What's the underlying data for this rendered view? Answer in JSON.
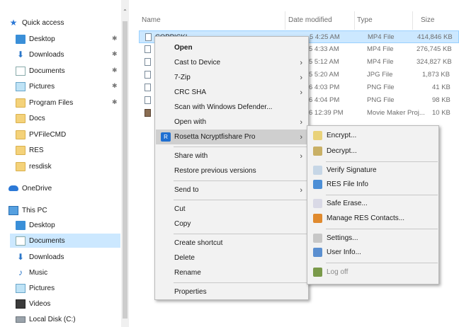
{
  "sidebar": {
    "items": [
      {
        "label": "Quick access",
        "icon": "star-icon",
        "pinned": false
      },
      {
        "label": "Desktop",
        "icon": "desktop-folder-icon",
        "pinned": true
      },
      {
        "label": "Downloads",
        "icon": "download-arrow-icon",
        "pinned": true
      },
      {
        "label": "Documents",
        "icon": "document-icon",
        "pinned": true
      },
      {
        "label": "Pictures",
        "icon": "pictures-icon",
        "pinned": true
      },
      {
        "label": "Program Files",
        "icon": "folder-icon",
        "pinned": true
      },
      {
        "label": "Docs",
        "icon": "folder-icon",
        "pinned": false
      },
      {
        "label": "PVFileCMD",
        "icon": "folder-icon",
        "pinned": false
      },
      {
        "label": "RES",
        "icon": "folder-icon",
        "pinned": false
      },
      {
        "label": "resdisk",
        "icon": "folder-icon",
        "pinned": false
      },
      {
        "label": "OneDrive",
        "icon": "cloud-icon",
        "pinned": false
      },
      {
        "label": "This PC",
        "icon": "computer-icon",
        "pinned": false
      },
      {
        "label": "Desktop",
        "icon": "desktop-folder-icon",
        "pinned": false
      },
      {
        "label": "Documents",
        "icon": "document-icon",
        "pinned": false
      },
      {
        "label": "Downloads",
        "icon": "download-arrow-icon",
        "pinned": false
      },
      {
        "label": "Music",
        "icon": "music-icon",
        "pinned": false
      },
      {
        "label": "Pictures",
        "icon": "pictures-icon",
        "pinned": false
      },
      {
        "label": "Videos",
        "icon": "video-icon",
        "pinned": false
      },
      {
        "label": "Local Disk (C:)",
        "icon": "disk-icon",
        "pinned": false
      }
    ],
    "pin_glyph": "✱"
  },
  "header": {
    "name": "Name",
    "date_modified": "Date modified",
    "type": "Type",
    "size": "Size",
    "sort_glyph": "⌃"
  },
  "files": [
    {
      "name": "COPPICKI",
      "date": "5 4:25 AM",
      "type": "MP4 File",
      "size": "414,846 KB"
    },
    {
      "name": "",
      "date": "5 4:33 AM",
      "type": "MP4 File",
      "size": "276,745 KB"
    },
    {
      "name": "",
      "date": "5 5:12 AM",
      "type": "MP4 File",
      "size": "324,827 KB"
    },
    {
      "name": "",
      "date": "5 5:20 AM",
      "type": "JPG File",
      "size": "1,873 KB"
    },
    {
      "name": "",
      "date": "6 4:03 PM",
      "type": "PNG File",
      "size": "41 KB"
    },
    {
      "name": "",
      "date": "6 4:04 PM",
      "type": "PNG File",
      "size": "98 KB"
    },
    {
      "name": "",
      "date": "6 12:39 PM",
      "type": "Movie Maker Proj...",
      "size": "10 KB"
    }
  ],
  "context_menu": {
    "items": [
      {
        "label": "Open",
        "bold": true,
        "submenu": false
      },
      {
        "label": "Cast to Device",
        "submenu": true
      },
      {
        "label": "7-Zip",
        "submenu": true
      },
      {
        "label": "CRC SHA",
        "submenu": true
      },
      {
        "label": "Scan with Windows Defender...",
        "submenu": false
      },
      {
        "label": "Open with",
        "submenu": true
      },
      {
        "label": "Rosetta Ncryptfishare Pro",
        "submenu": true,
        "highlighted": true,
        "icon": "rosetta-app-icon"
      },
      {
        "label": "Share with",
        "submenu": true
      },
      {
        "label": "Restore previous versions",
        "submenu": false
      },
      {
        "label": "Send to",
        "submenu": true
      },
      {
        "label": "Cut",
        "submenu": false
      },
      {
        "label": "Copy",
        "submenu": false
      },
      {
        "label": "Create shortcut",
        "submenu": false
      },
      {
        "label": "Delete",
        "submenu": false
      },
      {
        "label": "Rename",
        "submenu": false
      },
      {
        "label": "Properties",
        "submenu": false
      }
    ],
    "arrow_glyph": "›",
    "rosetta_icon_glyph": "R"
  },
  "submenu": {
    "items": [
      {
        "label": "Encrypt...",
        "icon": "encrypt-icon",
        "color": "#e9d27a"
      },
      {
        "label": "Decrypt...",
        "icon": "decrypt-icon",
        "color": "#c9b066"
      },
      {
        "label": "Verify Signature",
        "icon": "verify-signature-icon",
        "color": "#c6d6e6"
      },
      {
        "label": "RES File Info",
        "icon": "file-info-icon",
        "color": "#4d8fd6"
      },
      {
        "label": "Safe Erase...",
        "icon": "safe-erase-icon",
        "color": "#d9d9e6"
      },
      {
        "label": "Manage RES Contacts...",
        "icon": "contacts-icon",
        "color": "#e08a2e"
      },
      {
        "label": "Settings...",
        "icon": "settings-icon",
        "color": "#c7c7c7"
      },
      {
        "label": "User Info...",
        "icon": "user-info-icon",
        "color": "#5b8fd0"
      },
      {
        "label": "Log off",
        "icon": "log-off-icon",
        "color": "#7a9a4a",
        "disabled": true
      }
    ]
  }
}
